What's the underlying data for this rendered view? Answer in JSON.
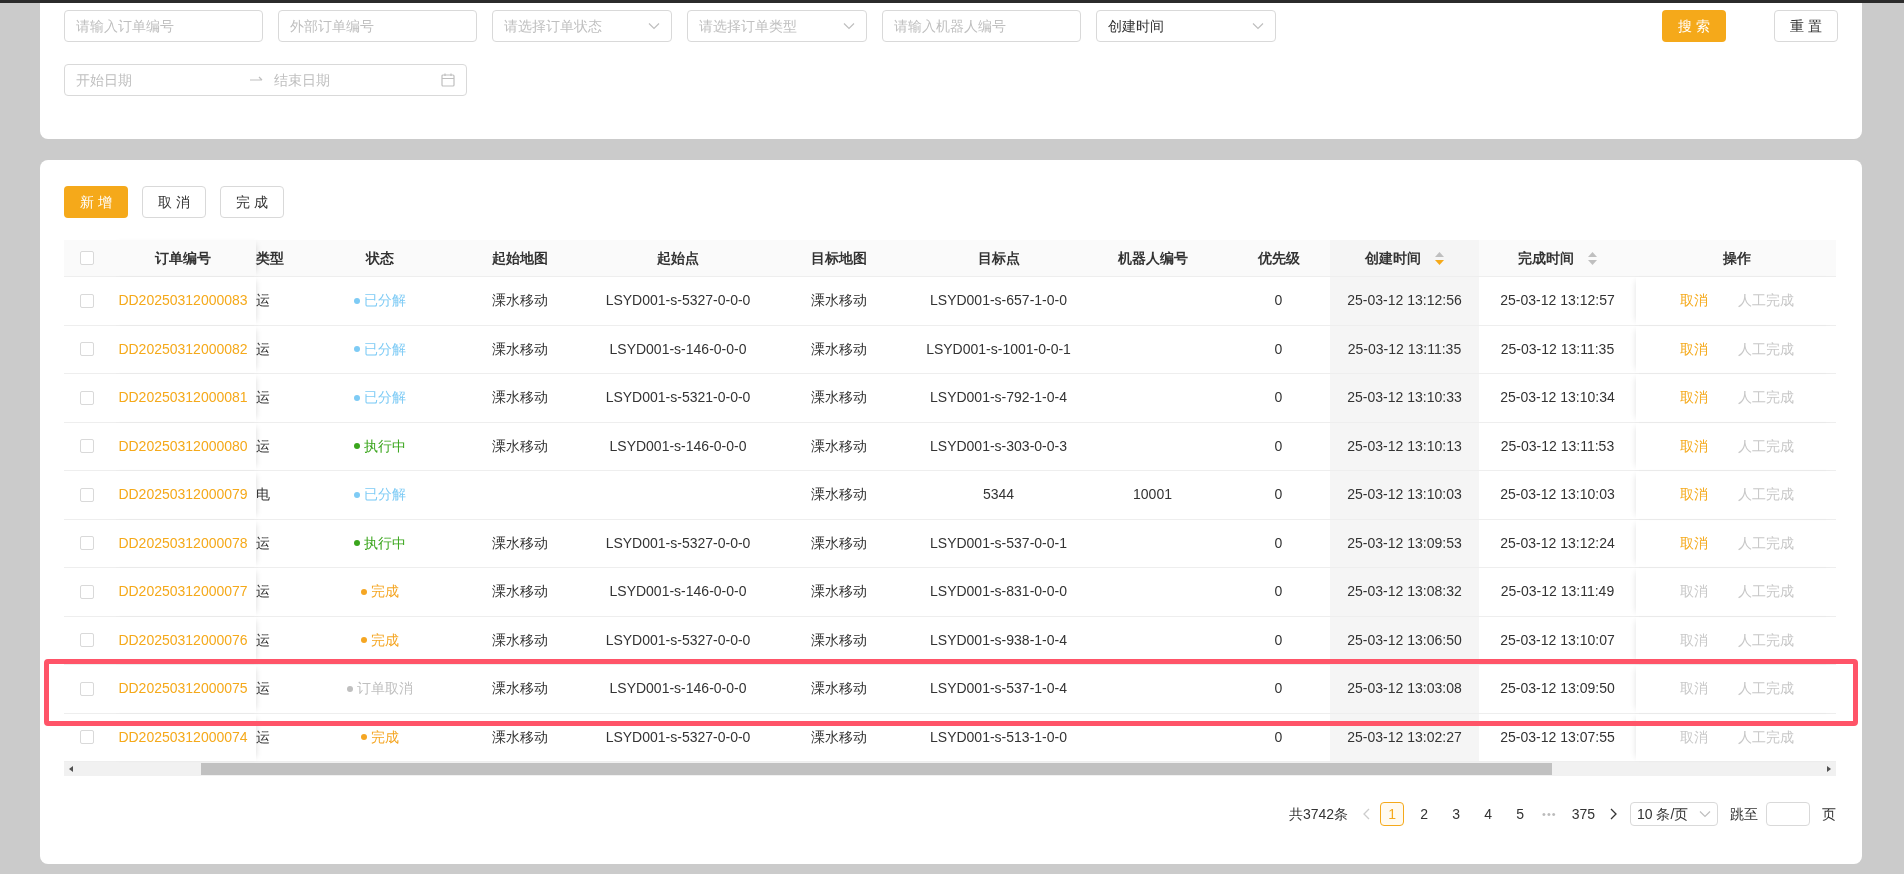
{
  "filters": [
    {
      "kind": "input",
      "placeholder": "请输入订单编号"
    },
    {
      "kind": "input",
      "placeholder": "外部订单编号"
    },
    {
      "kind": "select",
      "placeholder": "请选择订单状态"
    },
    {
      "kind": "select",
      "placeholder": "请选择订单类型"
    },
    {
      "kind": "input",
      "placeholder": "请输入机器人编号"
    },
    {
      "kind": "select",
      "value": "创建时间"
    }
  ],
  "search_button": "搜 索",
  "reset_button": "重 置",
  "date_range": {
    "start_placeholder": "开始日期",
    "end_placeholder": "结束日期"
  },
  "toolbar": [
    {
      "label": "新 增",
      "primary": true
    },
    {
      "label": "取 消",
      "primary": false
    },
    {
      "label": "完 成",
      "primary": false
    }
  ],
  "all_checked": false,
  "columns": [
    {
      "label": "订单编号"
    },
    {
      "label": "类型"
    },
    {
      "label": "状态"
    },
    {
      "label": "起始地图"
    },
    {
      "label": "起始点"
    },
    {
      "label": "目标地图"
    },
    {
      "label": "目标点"
    },
    {
      "label": "机器人编号"
    },
    {
      "label": "优先级"
    },
    {
      "label": "创建时间",
      "sortable": true,
      "sorted_desc": true
    },
    {
      "label": "完成时间",
      "sortable": true,
      "sorted_desc": false
    },
    {
      "label": "操作"
    }
  ],
  "rows": [
    {
      "checked": false,
      "order_no": "DD20250312000083",
      "type": "运",
      "status": {
        "text": "已分解",
        "color": "#7ecbf5"
      },
      "start_map": "溧水移动",
      "start_point": "LSYD001-s-5327-0-0-0",
      "target_map": "溧水移动",
      "target_point": "LSYD001-s-657-1-0-0",
      "robot": "",
      "priority": "0",
      "created": "25-03-12 13:12:56",
      "finished": "25-03-12 13:12:57",
      "cancel": "取消",
      "cancel_enabled": true,
      "complete": "人工完成",
      "complete_enabled": false,
      "highlighted": false
    },
    {
      "checked": false,
      "order_no": "DD20250312000082",
      "type": "运",
      "status": {
        "text": "已分解",
        "color": "#7ecbf5"
      },
      "start_map": "溧水移动",
      "start_point": "LSYD001-s-146-0-0-0",
      "target_map": "溧水移动",
      "target_point": "LSYD001-s-1001-0-0-1",
      "robot": "",
      "priority": "0",
      "created": "25-03-12 13:11:35",
      "finished": "25-03-12 13:11:35",
      "cancel": "取消",
      "cancel_enabled": true,
      "complete": "人工完成",
      "complete_enabled": false,
      "highlighted": false
    },
    {
      "checked": false,
      "order_no": "DD20250312000081",
      "type": "运",
      "status": {
        "text": "已分解",
        "color": "#7ecbf5"
      },
      "start_map": "溧水移动",
      "start_point": "LSYD001-s-5321-0-0-0",
      "target_map": "溧水移动",
      "target_point": "LSYD001-s-792-1-0-4",
      "robot": "",
      "priority": "0",
      "created": "25-03-12 13:10:33",
      "finished": "25-03-12 13:10:34",
      "cancel": "取消",
      "cancel_enabled": true,
      "complete": "人工完成",
      "complete_enabled": false,
      "highlighted": false
    },
    {
      "checked": false,
      "order_no": "DD20250312000080",
      "type": "运",
      "status": {
        "text": "执行中",
        "color": "#3aa51c"
      },
      "start_map": "溧水移动",
      "start_point": "LSYD001-s-146-0-0-0",
      "target_map": "溧水移动",
      "target_point": "LSYD001-s-303-0-0-3",
      "robot": "",
      "priority": "0",
      "created": "25-03-12 13:10:13",
      "finished": "25-03-12 13:11:53",
      "cancel": "取消",
      "cancel_enabled": true,
      "complete": "人工完成",
      "complete_enabled": false,
      "highlighted": false
    },
    {
      "checked": false,
      "order_no": "DD20250312000079",
      "type": "电",
      "status": {
        "text": "已分解",
        "color": "#7ecbf5"
      },
      "start_map": "",
      "start_point": "",
      "target_map": "溧水移动",
      "target_point": "5344",
      "robot": "10001",
      "priority": "0",
      "created": "25-03-12 13:10:03",
      "finished": "25-03-12 13:10:03",
      "cancel": "取消",
      "cancel_enabled": true,
      "complete": "人工完成",
      "complete_enabled": false,
      "highlighted": false
    },
    {
      "checked": false,
      "order_no": "DD20250312000078",
      "type": "运",
      "status": {
        "text": "执行中",
        "color": "#3aa51c"
      },
      "start_map": "溧水移动",
      "start_point": "LSYD001-s-5327-0-0-0",
      "target_map": "溧水移动",
      "target_point": "LSYD001-s-537-0-0-1",
      "robot": "",
      "priority": "0",
      "created": "25-03-12 13:09:53",
      "finished": "25-03-12 13:12:24",
      "cancel": "取消",
      "cancel_enabled": true,
      "complete": "人工完成",
      "complete_enabled": false,
      "highlighted": false
    },
    {
      "checked": false,
      "order_no": "DD20250312000077",
      "type": "运",
      "status": {
        "text": "完成",
        "color": "#f5a623"
      },
      "start_map": "溧水移动",
      "start_point": "LSYD001-s-146-0-0-0",
      "target_map": "溧水移动",
      "target_point": "LSYD001-s-831-0-0-0",
      "robot": "",
      "priority": "0",
      "created": "25-03-12 13:08:32",
      "finished": "25-03-12 13:11:49",
      "cancel": "取消",
      "cancel_enabled": false,
      "complete": "人工完成",
      "complete_enabled": false,
      "highlighted": false
    },
    {
      "checked": false,
      "order_no": "DD20250312000076",
      "type": "运",
      "status": {
        "text": "完成",
        "color": "#f5a623"
      },
      "start_map": "溧水移动",
      "start_point": "LSYD001-s-5327-0-0-0",
      "target_map": "溧水移动",
      "target_point": "LSYD001-s-938-1-0-4",
      "robot": "",
      "priority": "0",
      "created": "25-03-12 13:06:50",
      "finished": "25-03-12 13:10:07",
      "cancel": "取消",
      "cancel_enabled": false,
      "complete": "人工完成",
      "complete_enabled": false,
      "highlighted": false
    },
    {
      "checked": false,
      "order_no": "DD20250312000075",
      "type": "运",
      "status": {
        "text": "订单取消",
        "color": "#bfbfbf"
      },
      "start_map": "溧水移动",
      "start_point": "LSYD001-s-146-0-0-0",
      "target_map": "溧水移动",
      "target_point": "LSYD001-s-537-1-0-4",
      "robot": "",
      "priority": "0",
      "created": "25-03-12 13:03:08",
      "finished": "25-03-12 13:09:50",
      "cancel": "取消",
      "cancel_enabled": false,
      "complete": "人工完成",
      "complete_enabled": false,
      "highlighted": true
    },
    {
      "checked": false,
      "order_no": "DD20250312000074",
      "type": "运",
      "status": {
        "text": "完成",
        "color": "#f5a623"
      },
      "start_map": "溧水移动",
      "start_point": "LSYD001-s-5327-0-0-0",
      "target_map": "溧水移动",
      "target_point": "LSYD001-s-513-1-0-0",
      "robot": "",
      "priority": "0",
      "created": "25-03-12 13:02:27",
      "finished": "25-03-12 13:07:55",
      "cancel": "取消",
      "cancel_enabled": false,
      "complete": "人工完成",
      "complete_enabled": false,
      "highlighted": false
    }
  ],
  "pagination": {
    "total": "共3742条",
    "prev_disabled": true,
    "next_disabled": false,
    "pages": [
      {
        "kind": "page",
        "label": "1",
        "selected": true
      },
      {
        "kind": "page",
        "label": "2",
        "selected": false
      },
      {
        "kind": "page",
        "label": "3",
        "selected": false
      },
      {
        "kind": "page",
        "label": "4",
        "selected": false
      },
      {
        "kind": "page",
        "label": "5",
        "selected": false
      },
      {
        "kind": "ellipsis",
        "label": "•••"
      },
      {
        "kind": "page",
        "label": "375",
        "selected": false
      }
    ],
    "page_size": "10 条/页",
    "jump_label": "跳至",
    "page_suffix": "页"
  }
}
